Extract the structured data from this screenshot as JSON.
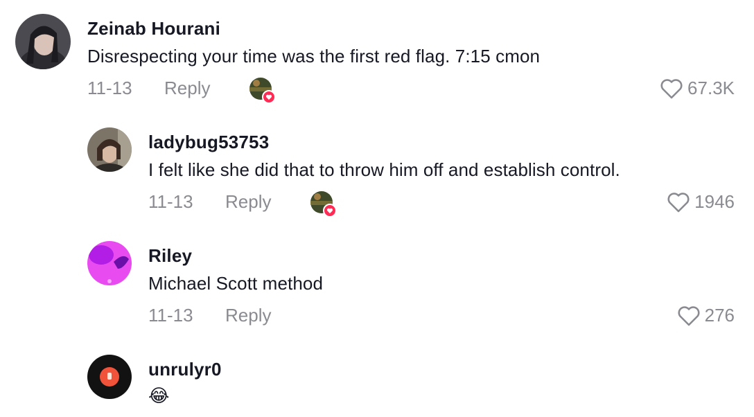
{
  "comments": [
    {
      "username": "Zeinab Hourani",
      "text": "Disrespecting your time was the first red flag. 7:15 cmon",
      "date": "11-13",
      "reply_label": "Reply",
      "likes": "67.3K",
      "creator_liked": true
    },
    {
      "username": "ladybug53753",
      "text": "I felt like she did that to throw him off and establish control.",
      "date": "11-13",
      "reply_label": "Reply",
      "likes": "1946",
      "creator_liked": true
    },
    {
      "username": "Riley",
      "text": "Michael Scott method",
      "date": "11-13",
      "reply_label": "Reply",
      "likes": "276",
      "creator_liked": false
    },
    {
      "username": "unrulyr0",
      "text": "😂"
    }
  ],
  "icons": {
    "like": "heart-outline-icon",
    "creator_liked": "creator-liked-heart-icon"
  },
  "colors": {
    "text": "#161823",
    "muted": "#8a8b91",
    "liked_badge": "#fe2c55"
  }
}
